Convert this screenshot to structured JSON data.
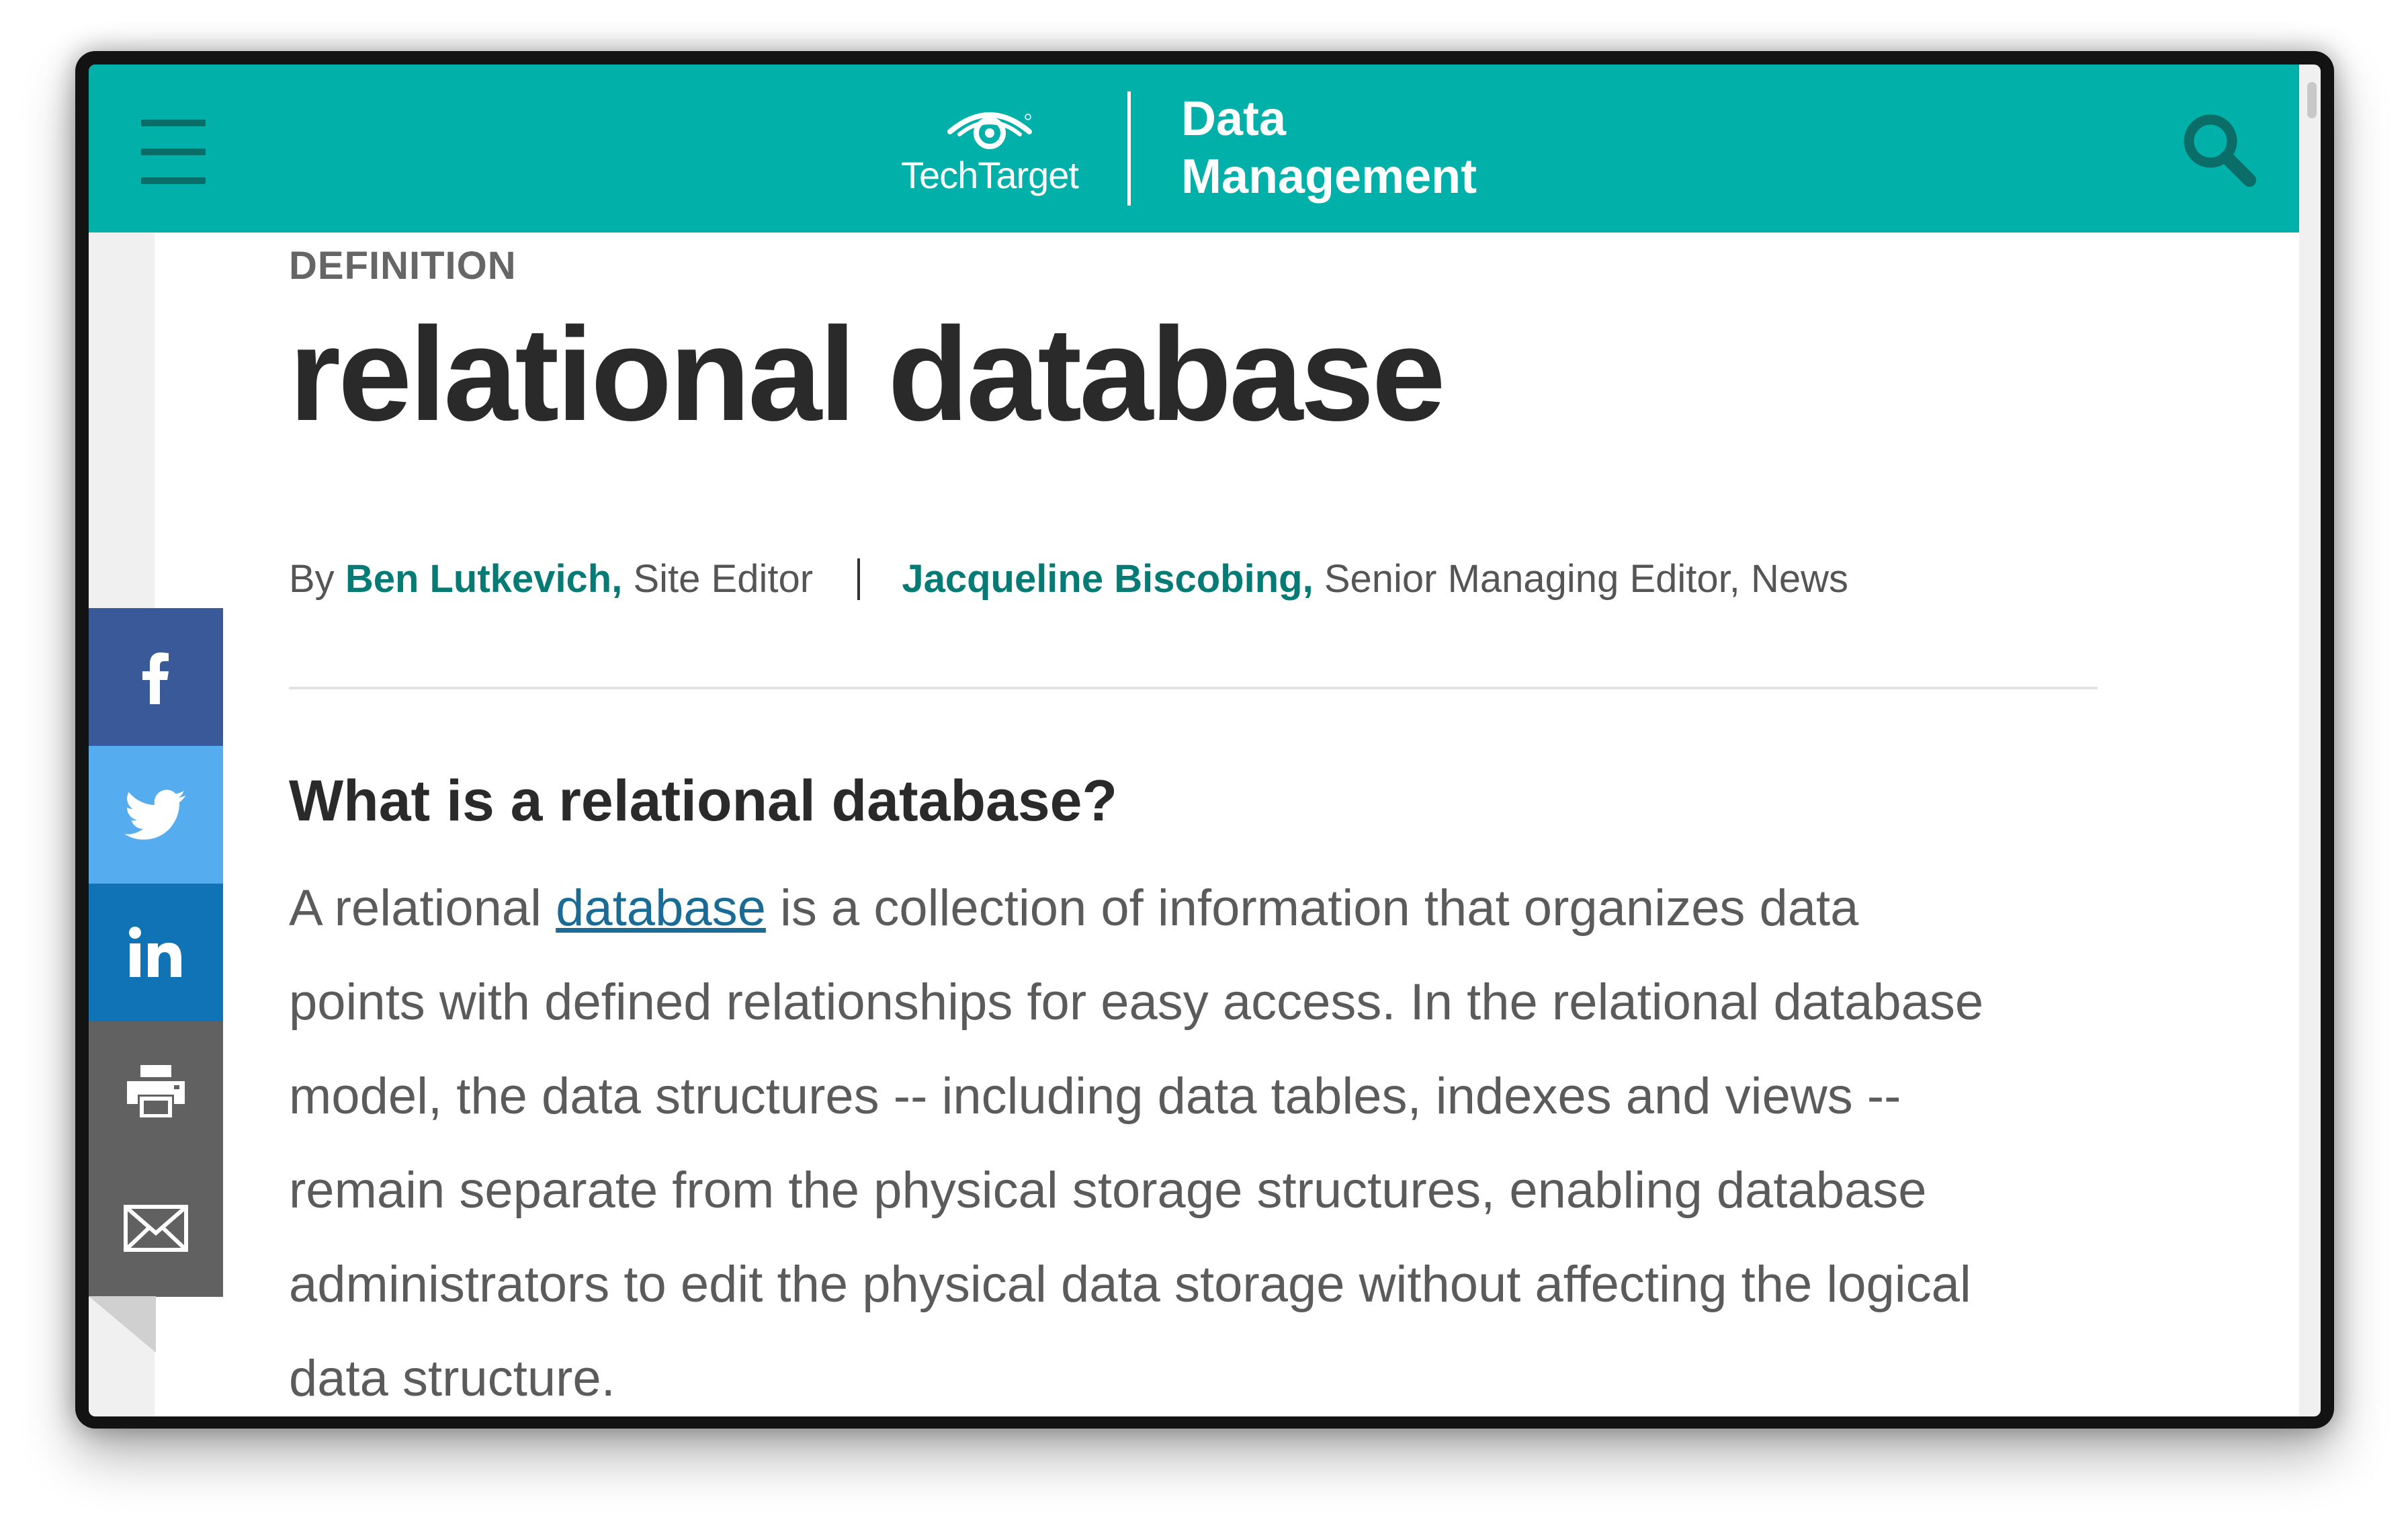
{
  "header": {
    "brand": "TechTarget",
    "site_name_line1": "Data",
    "site_name_line2": "Management",
    "menu_icon": "hamburger-menu-icon",
    "search_icon": "search-icon",
    "colors": {
      "header_bg": "#01b0a8",
      "icon": "#0a6d67"
    }
  },
  "article": {
    "kicker": "DEFINITION",
    "title": "relational database",
    "byline": {
      "prefix": "By",
      "author1_name": "Ben Lutkevich,",
      "author1_role": "Site Editor",
      "author2_name": "Jacqueline Biscobing,",
      "author2_role": "Senior Managing Editor, News"
    },
    "section_heading": "What is a relational database?",
    "body": {
      "line1_before": "A relational",
      "line1_link": "database",
      "line1_after": "is a collection of information that organizes data",
      "line2": "points with defined relationships for easy access. In the relational database",
      "line3": "model, the data structures -- including data tables, indexes and views --",
      "line4": "remain separate from the physical storage structures, enabling database",
      "line5": "administrators to edit the physical data storage without affecting the logical",
      "line6": "data structure."
    }
  },
  "share_bar": [
    {
      "icon": "facebook-icon",
      "color": "#3a5999"
    },
    {
      "icon": "twitter-icon",
      "color": "#55acee"
    },
    {
      "icon": "linkedin-icon",
      "color": "#0f73b5"
    },
    {
      "icon": "print-icon",
      "color": "#616161"
    },
    {
      "icon": "email-icon",
      "color": "#616161"
    }
  ],
  "colors": {
    "author_link": "#067a74",
    "body_link": "#1a6c96",
    "title_text": "#2a2a2a",
    "body_text": "#5b5b5b"
  }
}
